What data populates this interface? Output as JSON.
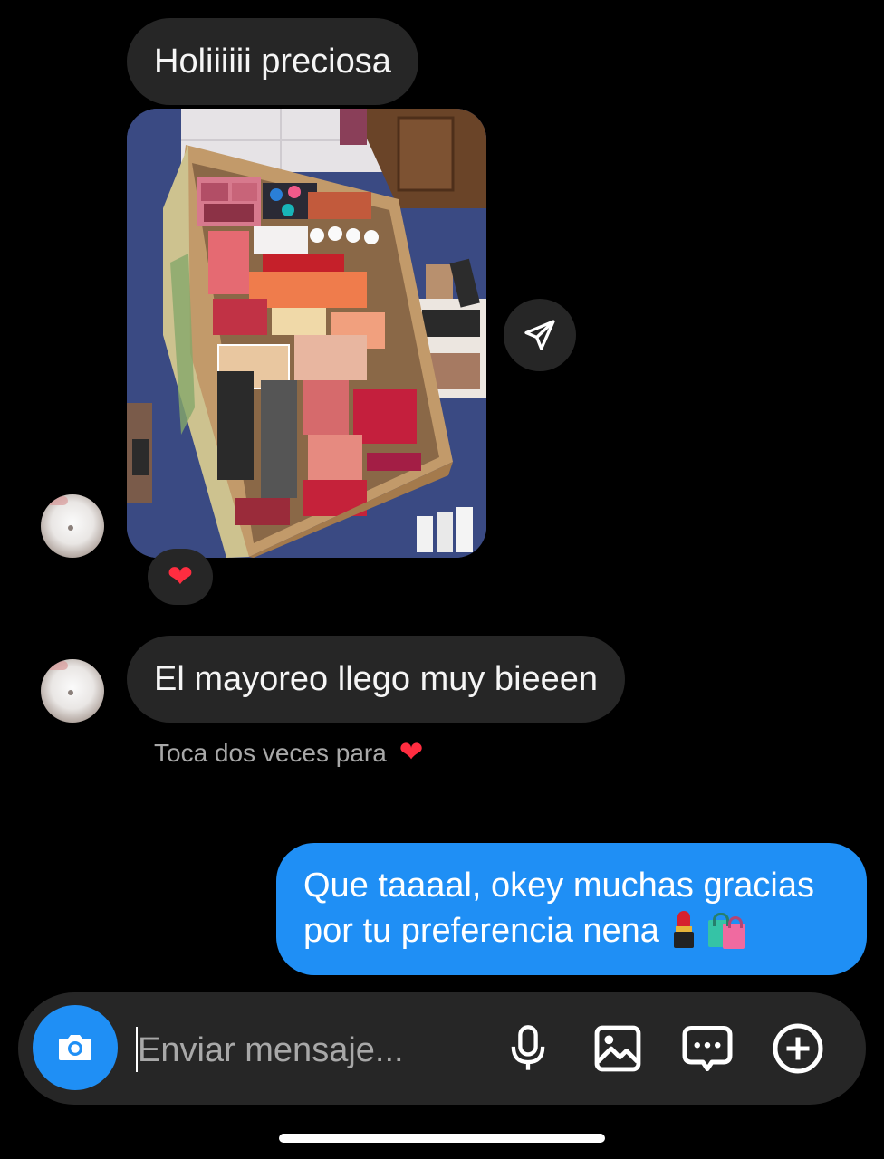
{
  "conversation": {
    "messages": [
      {
        "direction": "incoming",
        "type": "text",
        "text": "Holiiiiii preciosa"
      },
      {
        "direction": "incoming",
        "type": "photo",
        "reaction": "❤️"
      },
      {
        "direction": "incoming",
        "type": "text",
        "text": "El mayoreo llego muy bieeen"
      },
      {
        "direction": "outgoing",
        "type": "text",
        "line1": "Que taaaal, okey muchas gracias",
        "line2": "por tu preferencia nena"
      }
    ],
    "double_tap_hint": "Toca dos veces para",
    "hint_heart": "❤",
    "reaction_heart": "❤"
  },
  "icons": {
    "share": "send-paper-plane-icon",
    "camera": "camera-icon",
    "mic": "microphone-icon",
    "gallery": "image-gallery-icon",
    "sticker": "chat-bubble-dots-icon",
    "plus": "plus-circle-icon",
    "emoji1": "lipstick-emoji",
    "emoji2": "shopping-bags-emoji"
  },
  "composer": {
    "placeholder": "Enviar mensaje..."
  },
  "colors": {
    "background": "#000000",
    "incoming_bubble": "#262626",
    "outgoing_bubble": "#1f8ff5",
    "accent_blue": "#1f8ff5",
    "heart": "#ff2d40"
  }
}
